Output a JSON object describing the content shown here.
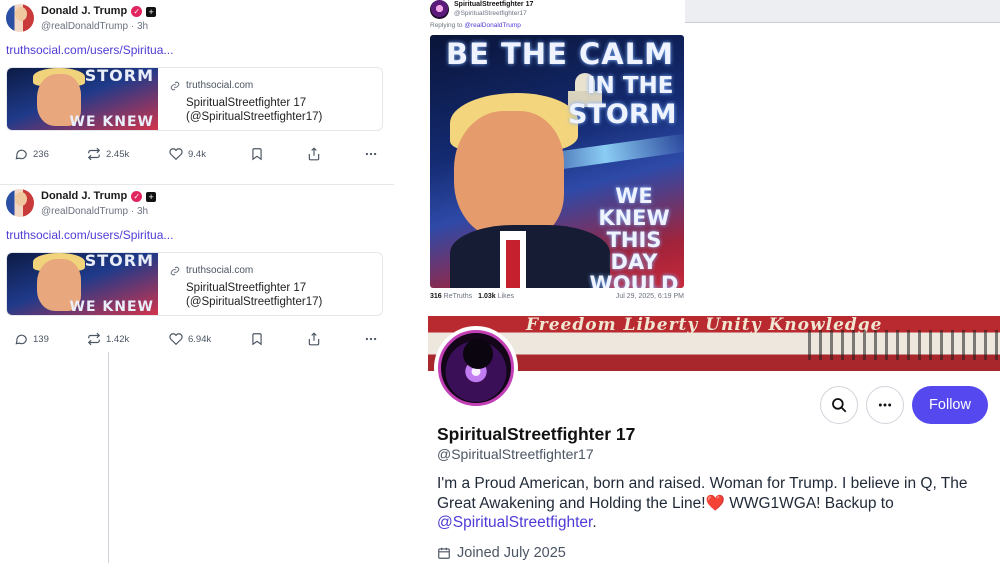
{
  "left_posts": [
    {
      "display_name": "Donald J. Trump",
      "handle": "@realDonaldTrump",
      "time": "3h",
      "link_text": "truthsocial.com/users/Spiritua...",
      "card": {
        "domain": "truthsocial.com",
        "title_line1": "SpiritualStreetfighter 17",
        "title_line2": "(@SpiritualStreetfighter17)",
        "thumb_top": "STORM",
        "thumb_bottom": "WE KNEW"
      },
      "stats": {
        "replies": "236",
        "retruths": "2.45k",
        "likes": "9.4k"
      }
    },
    {
      "display_name": "Donald J. Trump",
      "handle": "@realDonaldTrump",
      "time": "3h",
      "link_text": "truthsocial.com/users/Spiritua...",
      "card": {
        "domain": "truthsocial.com",
        "title_line1": "SpiritualStreetfighter 17",
        "title_line2": "(@SpiritualStreetfighter17)",
        "thumb_top": "STORM",
        "thumb_bottom": "WE KNEW"
      },
      "stats": {
        "replies": "139",
        "retruths": "1.42k",
        "likes": "6.94k"
      }
    }
  ],
  "repost": {
    "display_name": "SpiritualStreetfighter 17",
    "handle": "@SpiritualStreetfighter17",
    "replying_prefix": "Replying to",
    "replying_to": "@realDonaldTrump",
    "poster": {
      "line1": "BE THE CALM",
      "line2": "IN THE",
      "line3": "STORM",
      "line4": "WE KNEW THIS DAY WOULD COME"
    },
    "retruths_count": "316",
    "retruths_label": "ReTruths",
    "likes_count": "1.03k",
    "likes_label": "Likes",
    "date": "Jul 29, 2025, 6:19 PM"
  },
  "profile": {
    "banner_text": "Freedom Liberty Unity Knowledge",
    "display_name": "SpiritualStreetfighter 17",
    "handle": "@SpiritualStreetfighter17",
    "follow_label": "Follow",
    "bio_text": "I'm a Proud American, born and raised. Woman for Trump. I believe in Q, The Great Awakening and Holding the Line!",
    "bio_heart": "❤️",
    "bio_text2": " WWG1WGA! Backup to ",
    "bio_mention": "@SpiritualStreetfighter",
    "bio_end": ".",
    "joined": "Joined July 2025"
  },
  "colors": {
    "accent": "#5448ee",
    "link": "#4d3bd6",
    "verified": "#e0245e"
  },
  "icons": [
    "reply-icon",
    "retruth-icon",
    "like-icon",
    "bookmark-icon",
    "share-icon",
    "more-icon",
    "link-icon",
    "search-icon",
    "calendar-icon",
    "verified-icon"
  ]
}
